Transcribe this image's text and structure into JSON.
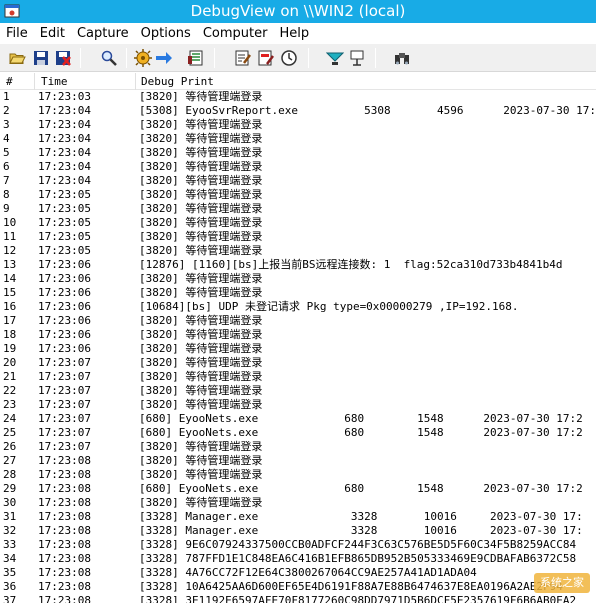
{
  "window": {
    "title": "DebugView on \\\\WIN2 (local)"
  },
  "menu": [
    "File",
    "Edit",
    "Capture",
    "Options",
    "Computer",
    "Help"
  ],
  "toolbar": [
    {
      "name": "open-icon"
    },
    {
      "name": "save-icon"
    },
    {
      "name": "clear-save-icon"
    },
    {
      "name": "find-icon"
    },
    {
      "name": "capture-icon"
    },
    {
      "name": "autoscroll-icon"
    },
    {
      "name": "clear-display-icon"
    },
    {
      "name": "filter-icon"
    },
    {
      "name": "highlight-icon"
    },
    {
      "name": "clock-icon"
    },
    {
      "name": "capture-kernel-icon"
    },
    {
      "name": "pass-through-icon"
    },
    {
      "name": "binoculars-icon"
    }
  ],
  "columns": {
    "num": "#",
    "time": "Time",
    "message": "Debug Print"
  },
  "rows": [
    {
      "n": "1",
      "t": "17:23:03",
      "m": "[3820] 等待管理端登录"
    },
    {
      "n": "2",
      "t": "17:23:04",
      "m": "[5308] EyooSvrReport.exe          5308       4596      2023-07-30 17:"
    },
    {
      "n": "3",
      "t": "17:23:04",
      "m": "[3820] 等待管理端登录"
    },
    {
      "n": "4",
      "t": "17:23:04",
      "m": "[3820] 等待管理端登录"
    },
    {
      "n": "5",
      "t": "17:23:04",
      "m": "[3820] 等待管理端登录"
    },
    {
      "n": "6",
      "t": "17:23:04",
      "m": "[3820] 等待管理端登录"
    },
    {
      "n": "7",
      "t": "17:23:04",
      "m": "[3820] 等待管理端登录"
    },
    {
      "n": "8",
      "t": "17:23:05",
      "m": "[3820] 等待管理端登录"
    },
    {
      "n": "9",
      "t": "17:23:05",
      "m": "[3820] 等待管理端登录"
    },
    {
      "n": "10",
      "t": "17:23:05",
      "m": "[3820] 等待管理端登录"
    },
    {
      "n": "11",
      "t": "17:23:05",
      "m": "[3820] 等待管理端登录"
    },
    {
      "n": "12",
      "t": "17:23:05",
      "m": "[3820] 等待管理端登录"
    },
    {
      "n": "13",
      "t": "17:23:06",
      "m": "[12876] [1160][bs]上报当前BS远程连接数: 1  flag:52ca310d733b4841b4d"
    },
    {
      "n": "14",
      "t": "17:23:06",
      "m": "[3820] 等待管理端登录"
    },
    {
      "n": "15",
      "t": "17:23:06",
      "m": "[3820] 等待管理端登录"
    },
    {
      "n": "16",
      "t": "17:23:06",
      "m": "[10684][bs] UDP 未登记请求 Pkg type=0x00000279 ,IP=192.168."
    },
    {
      "n": "17",
      "t": "17:23:06",
      "m": "[3820] 等待管理端登录"
    },
    {
      "n": "18",
      "t": "17:23:06",
      "m": "[3820] 等待管理端登录"
    },
    {
      "n": "19",
      "t": "17:23:06",
      "m": "[3820] 等待管理端登录"
    },
    {
      "n": "20",
      "t": "17:23:07",
      "m": "[3820] 等待管理端登录"
    },
    {
      "n": "21",
      "t": "17:23:07",
      "m": "[3820] 等待管理端登录"
    },
    {
      "n": "22",
      "t": "17:23:07",
      "m": "[3820] 等待管理端登录"
    },
    {
      "n": "23",
      "t": "17:23:07",
      "m": "[3820] 等待管理端登录"
    },
    {
      "n": "24",
      "t": "17:23:07",
      "m": "[680] EyooNets.exe             680        1548      2023-07-30 17:2"
    },
    {
      "n": "25",
      "t": "17:23:07",
      "m": "[680] EyooNets.exe             680        1548      2023-07-30 17:2"
    },
    {
      "n": "26",
      "t": "17:23:07",
      "m": "[3820] 等待管理端登录"
    },
    {
      "n": "27",
      "t": "17:23:08",
      "m": "[3820] 等待管理端登录"
    },
    {
      "n": "28",
      "t": "17:23:08",
      "m": "[3820] 等待管理端登录"
    },
    {
      "n": "29",
      "t": "17:23:08",
      "m": "[680] EyooNets.exe             680        1548      2023-07-30 17:2"
    },
    {
      "n": "30",
      "t": "17:23:08",
      "m": "[3820] 等待管理端登录"
    },
    {
      "n": "31",
      "t": "17:23:08",
      "m": "[3328] Manager.exe              3328       10016     2023-07-30 17:"
    },
    {
      "n": "32",
      "t": "17:23:08",
      "m": "[3328] Manager.exe              3328       10016     2023-07-30 17:"
    },
    {
      "n": "33",
      "t": "17:23:08",
      "m": "[3328] 9E6C07924337500CCB0ADFCF244F3C63C576BE5D5F60C34F5B8259ACC84"
    },
    {
      "n": "34",
      "t": "17:23:08",
      "m": "[3328] 787FFD1E1C848EA6C416B1EFB865DB952B505333469E9CDBAFAB6372C58"
    },
    {
      "n": "35",
      "t": "17:23:08",
      "m": "[3328] 4A76CC72F12E64C3800267064CC9AE257A41AD1ADA04"
    },
    {
      "n": "36",
      "t": "17:23:08",
      "m": "[3328] 10A6425AA6D600EF65E4D6191F88A7E88B6474637E8EA0196A2AE2F94"
    },
    {
      "n": "37",
      "t": "17:23:08",
      "m": "[3328] 3E1192E6597AFE70F8177260C98DD7971D5B6DCF5E2357619F6B6AB0EA2"
    }
  ],
  "watermark": "系统之家"
}
